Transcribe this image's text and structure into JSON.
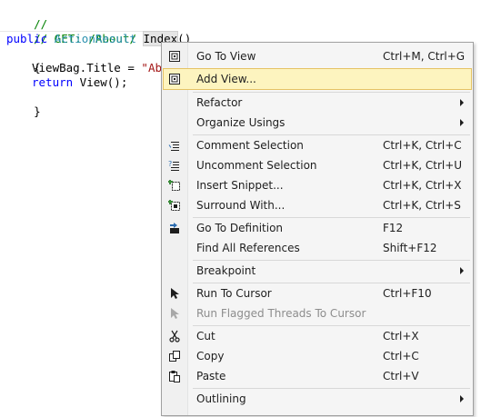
{
  "editor": {
    "line1": {
      "comment": "//"
    },
    "line2": {
      "comment": "// GET: /About/"
    },
    "line3": {
      "kw": "public",
      "type": "ActionResult",
      "method": "Index",
      "paren": "()"
    },
    "line4": {
      "text": "{"
    },
    "line5": {
      "ident": "ViewBag.Title = ",
      "string": "\"Abou"
    },
    "line6": {
      "kw": "return",
      "text": " View();"
    },
    "line7": {
      "text": "}"
    }
  },
  "context_menu": {
    "items": [
      {
        "label": "Go To View",
        "shortcut": "Ctrl+M, Ctrl+G",
        "icon": "go-to-view-icon"
      },
      {
        "label": "Add View...",
        "shortcut": "",
        "icon": "add-view-icon",
        "highlighted": true
      },
      {
        "label": "Refactor",
        "shortcut": "",
        "submenu": true
      },
      {
        "label": "Organize Usings",
        "shortcut": "",
        "submenu": true
      },
      {
        "label": "Comment Selection",
        "shortcut": "Ctrl+K, Ctrl+C",
        "icon": "comment-selection-icon"
      },
      {
        "label": "Uncomment Selection",
        "shortcut": "Ctrl+K, Ctrl+U",
        "icon": "uncomment-selection-icon"
      },
      {
        "label": "Insert Snippet...",
        "shortcut": "Ctrl+K, Ctrl+X",
        "icon": "insert-snippet-icon"
      },
      {
        "label": "Surround With...",
        "shortcut": "Ctrl+K, Ctrl+S",
        "icon": "surround-with-icon"
      },
      {
        "label": "Go To Definition",
        "shortcut": "F12",
        "icon": "go-to-definition-icon"
      },
      {
        "label": "Find All References",
        "shortcut": "Shift+F12"
      },
      {
        "label": "Breakpoint",
        "shortcut": "",
        "submenu": true
      },
      {
        "label": "Run To Cursor",
        "shortcut": "Ctrl+F10",
        "icon": "cursor-arrow-icon"
      },
      {
        "label": "Run Flagged Threads To Cursor",
        "shortcut": "",
        "icon": "cursor-arrow-icon",
        "disabled": true
      },
      {
        "label": "Cut",
        "shortcut": "Ctrl+X",
        "icon": "scissors-icon"
      },
      {
        "label": "Copy",
        "shortcut": "Ctrl+C",
        "icon": "copy-icon"
      },
      {
        "label": "Paste",
        "shortcut": "Ctrl+V",
        "icon": "paste-icon"
      },
      {
        "label": "Outlining",
        "shortcut": "",
        "submenu": true
      }
    ]
  },
  "colors": {
    "comment": "#008000",
    "keyword": "#0000ff",
    "type": "#2b91af",
    "string": "#a31515",
    "menu_background": "#f5f5f5",
    "highlight": "#fdf4bf"
  }
}
